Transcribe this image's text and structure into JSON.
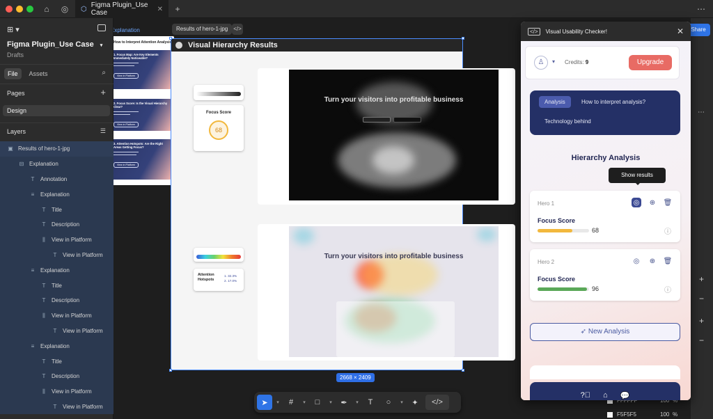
{
  "app": {
    "tab_title": "Figma Plugin_Use Case",
    "share_label": "Share"
  },
  "left_panel": {
    "file_title": "Figma Plugin_Use Case",
    "project": "Drafts",
    "tabs": [
      "File",
      "Assets"
    ],
    "pages_label": "Pages",
    "page_item": "Design",
    "layers_label": "Layers",
    "layers": [
      {
        "label": "Results of hero-1-jpg",
        "icon": "frame-icon",
        "indent": 0
      },
      {
        "label": "Explanation",
        "icon": "stack-icon",
        "indent": 1
      },
      {
        "label": "Annotation",
        "icon": "text-icon",
        "indent": 2
      },
      {
        "label": "Explanation",
        "icon": "list-icon",
        "indent": 2
      },
      {
        "label": "Title",
        "icon": "text-icon",
        "indent": 3
      },
      {
        "label": "Description",
        "icon": "text-icon",
        "indent": 3
      },
      {
        "label": "View in Platform",
        "icon": "bars-icon",
        "indent": 3
      },
      {
        "label": "View in Platform",
        "icon": "text-icon",
        "indent": 4
      },
      {
        "label": "Explanation",
        "icon": "list-icon",
        "indent": 2
      },
      {
        "label": "Title",
        "icon": "text-icon",
        "indent": 3
      },
      {
        "label": "Description",
        "icon": "text-icon",
        "indent": 3
      },
      {
        "label": "View in Platform",
        "icon": "bars-icon",
        "indent": 3
      },
      {
        "label": "View in Platform",
        "icon": "text-icon",
        "indent": 4
      },
      {
        "label": "Explanation",
        "icon": "list-icon",
        "indent": 2
      },
      {
        "label": "Title",
        "icon": "text-icon",
        "indent": 3
      },
      {
        "label": "Description",
        "icon": "text-icon",
        "indent": 3
      },
      {
        "label": "View in Platform",
        "icon": "bars-icon",
        "indent": 3
      },
      {
        "label": "View in Platform",
        "icon": "text-icon",
        "indent": 4
      }
    ]
  },
  "canvas": {
    "explanation_label": "Explanation",
    "frame_chip": "Results of hero-1-jpg",
    "code_chip": "</>",
    "frame_title": "Visual Hierarchy Results",
    "dimensions": "2668 × 2409",
    "explanation": {
      "heading": "How to Interpret Attention Analysis?",
      "cards": [
        {
          "title": "1. Focus Map: Are Key Elements Immediately Noticeable?",
          "button": "View in Platform"
        },
        {
          "title": "2. Focus Score: Is the Visual Hierarchy Clear?",
          "button": "View in Platform"
        },
        {
          "title": "3. Attention Hotspots: Are the Right Areas Getting Focus?",
          "button": "View in Platform"
        }
      ]
    },
    "focus_card": {
      "label": "Focus Score",
      "value": "68"
    },
    "hotspots_card": {
      "label": "Attention Hotspots",
      "items": [
        "1. 32.3%",
        "2. 17.0%"
      ]
    },
    "shot_headline": "Turn your visitors into profitable business"
  },
  "plugin": {
    "title": "Visual Usability Checker!",
    "credits_label": "Credits:",
    "credits_value": "9",
    "upgrade_label": "Upgrade",
    "nav": {
      "tabs": [
        "Analysis",
        "How to interpret analysis?",
        "Technology behind"
      ],
      "active": "Analysis"
    },
    "section_title": "Hierarchy Analysis",
    "tooltip": "Show results",
    "results": [
      {
        "name": "Hero 1",
        "score_label": "Focus Score",
        "score": 68,
        "bar_color": "#f2b83d"
      },
      {
        "name": "Hero 2",
        "score_label": "Focus Score",
        "score": 96,
        "bar_color": "#5aa858"
      }
    ],
    "new_analysis_label": "New Analysis"
  },
  "colors": {
    "accent": "#2f74e6",
    "navy": "#243066",
    "upgrade": "#e86b64"
  },
  "right_panel": {
    "swatches": [
      {
        "hex": "FFFFFF",
        "opacity": "100",
        "unit": "%"
      },
      {
        "hex": "F5F5F5",
        "opacity": "100",
        "unit": "%"
      }
    ]
  }
}
